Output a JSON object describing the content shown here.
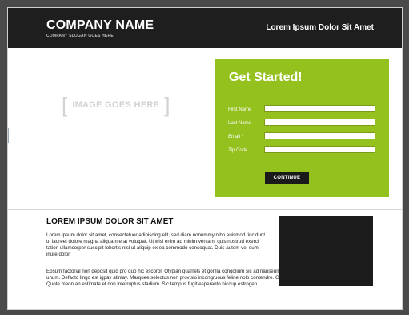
{
  "colors": {
    "header_bg": "#1e1e1e",
    "form_panel_bg": "#95c11f",
    "button_bg": "#1a1a1a",
    "placeholder_text": "#d2d2d2"
  },
  "header": {
    "company_name": "COMPANY NAME",
    "slogan": "COMPANY SLOGAN GOES HERE",
    "right_link": "Lorem Ipsum Dolor Sit Amet"
  },
  "hero": {
    "image_placeholder": {
      "left_bracket": "[",
      "text": "IMAGE GOES HERE",
      "right_bracket": "]"
    }
  },
  "form": {
    "title": "Get Started!",
    "fields": [
      {
        "label": "First Name",
        "value": ""
      },
      {
        "label": "Last Name",
        "value": ""
      },
      {
        "label": "Email *",
        "value": ""
      },
      {
        "label": "Zip Code",
        "value": ""
      }
    ],
    "button_label": "CONTINUE"
  },
  "content": {
    "heading": "LOREM IPSUM DOLOR SIT AMET",
    "paragraph1": "Lorem ipsum dolor sit amet, consectetuer adipiscing elit, sed diam nonummy nibh euismod tincidunt ut laoreet dolore magna aliquam erat volutpat. Ut wisi enim ad minim veniam, quis nostrud exerci tation ullamcorper suscipit lobortis nisl ut aliquip ex ea commodo consequat. Duis autem vel eum iriure dolor.",
    "paragraph2": "Epsum factorial non deposit quid pro quo hic escorol. Olypian quarrels et gorilla congolium sic ad nauseum. Souvlaki ignitus carborundum e pluribus unum. Defacto lingo est igpay atinlay. Marquee selectus non provisio incongruous feline nolo contendre. Gratuitous octopus niacin, sodium glutimate. Quote meon an estimate et non interruptus stadium. Sic tempus fugit esperanto hiccup estrogen."
  }
}
